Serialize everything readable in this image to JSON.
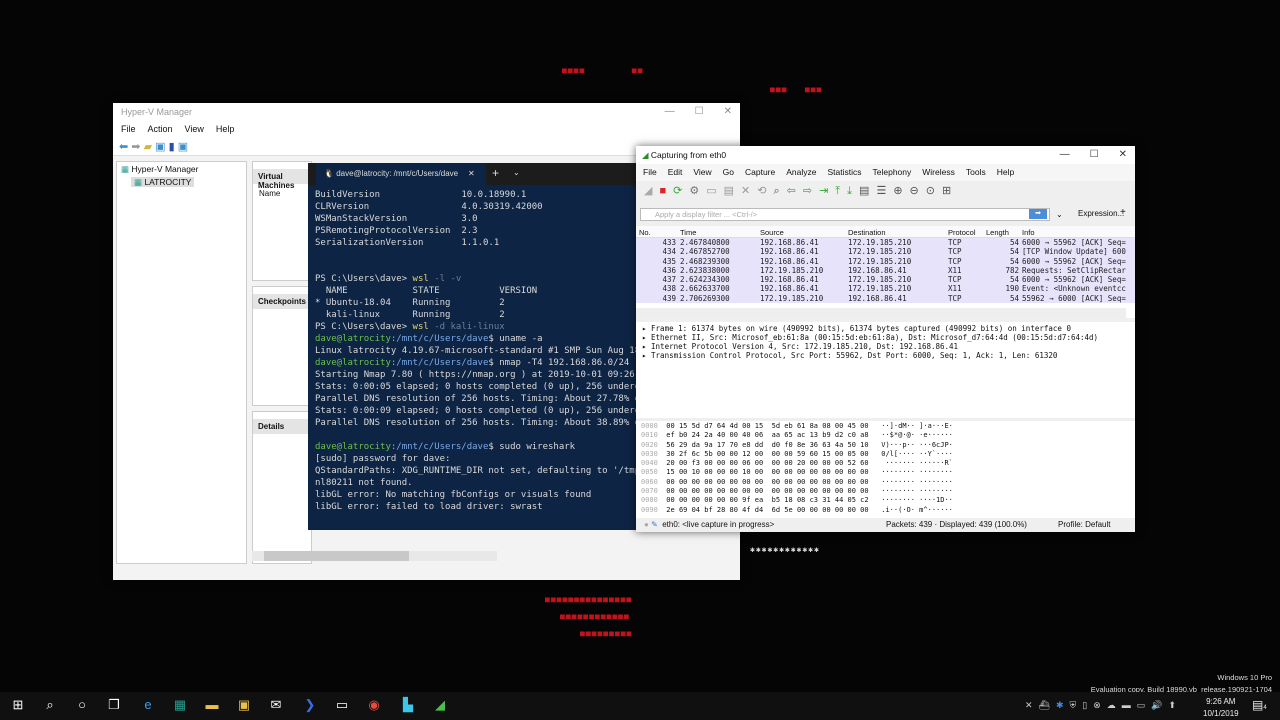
{
  "hyperv": {
    "title": "Hyper-V Manager",
    "menu": [
      "File",
      "Action",
      "View",
      "Help"
    ],
    "tree_root": "Hyper-V Manager",
    "tree_child": "LATROCITY",
    "vm_header": "Virtual Machines",
    "name_col": "Name",
    "checkpoints": "Checkpoints",
    "details": "Details"
  },
  "terminal": {
    "tab_title": "dave@latrocity: /mnt/c/Users/dave",
    "props": [
      [
        "BuildVersion",
        "10.0.18990.1"
      ],
      [
        "CLRVersion",
        "4.0.30319.42000"
      ],
      [
        "WSManStackVersion",
        "3.0"
      ],
      [
        "PSRemotingProtocolVersion",
        "2.3"
      ],
      [
        "SerializationVersion",
        "1.1.0.1"
      ]
    ],
    "lines": [
      {
        "p": "PS C:\\Users\\dave> ",
        "c": "wsl",
        "a": " -l -v"
      },
      {
        "t": "  NAME            STATE           VERSION"
      },
      {
        "t": "* Ubuntu-18.04    Running         2"
      },
      {
        "t": "  kali-linux      Running         2"
      },
      {
        "p": "PS C:\\Users\\dave> ",
        "c": "wsl",
        "a": " -d kali-linux"
      },
      {
        "u": "dave@latrocity",
        "d": ":/mnt/c/Users/dave",
        "s": "$ uname -a"
      },
      {
        "t": "Linux latrocity 4.19.67-microsoft-standard #1 SMP Sun Aug 18"
      },
      {
        "u": "dave@latrocity",
        "d": ":/mnt/c/Users/dave",
        "s": "$ nmap -T4 192.168.86.0/24"
      },
      {
        "t": "Starting Nmap 7.80 ( https://nmap.org ) at 2019-10-01 09:26"
      },
      {
        "t": "Stats: 0:00:05 elapsed; 0 hosts completed (0 up), 256 underg"
      },
      {
        "t": "Parallel DNS resolution of 256 hosts. Timing: About 27.78% d"
      },
      {
        "t": "Stats: 0:00:09 elapsed; 0 hosts completed (0 up), 256 underg"
      },
      {
        "t": "Parallel DNS resolution of 256 hosts. Timing: About 38.89% d"
      },
      {
        "t": ""
      },
      {
        "u": "dave@latrocity",
        "d": ":/mnt/c/Users/dave",
        "s": "$ sudo wireshark"
      },
      {
        "t": "[sudo] password for dave:"
      },
      {
        "t": "QStandardPaths: XDG_RUNTIME_DIR not set, defaulting to '/tmp"
      },
      {
        "t": "nl80211 not found."
      },
      {
        "t": "libGL error: No matching fbConfigs or visuals found"
      },
      {
        "t": "libGL error: failed to load driver: swrast"
      }
    ]
  },
  "wireshark": {
    "title": "Capturing from eth0",
    "menu": [
      "File",
      "Edit",
      "View",
      "Go",
      "Capture",
      "Analyze",
      "Statistics",
      "Telephony",
      "Wireless",
      "Tools",
      "Help"
    ],
    "filter_placeholder": "Apply a display filter ... <Ctrl-/>",
    "expression": "Expression...",
    "columns": [
      "No.",
      "Time",
      "Source",
      "Destination",
      "Protocol",
      "Length",
      "Info"
    ],
    "packets": [
      [
        "433",
        "2.467840800",
        "192.168.86.41",
        "172.19.185.210",
        "TCP",
        "54",
        "6000 → 55962 [ACK] Seq="
      ],
      [
        "434",
        "2.467852700",
        "192.168.86.41",
        "172.19.185.210",
        "TCP",
        "54",
        "[TCP Window Update] 600"
      ],
      [
        "435",
        "2.468239300",
        "192.168.86.41",
        "172.19.185.210",
        "TCP",
        "54",
        "6000 → 55962 [ACK] Seq="
      ],
      [
        "436",
        "2.623838000",
        "172.19.185.210",
        "192.168.86.41",
        "X11",
        "782",
        "Requests: SetClipRectar"
      ],
      [
        "437",
        "2.624234300",
        "192.168.86.41",
        "172.19.185.210",
        "TCP",
        "54",
        "6000 → 55962 [ACK] Seq="
      ],
      [
        "438",
        "2.662633700",
        "192.168.86.41",
        "172.19.185.210",
        "X11",
        "190",
        "Event: <Unknown eventcc"
      ],
      [
        "439",
        "2.706269300",
        "172.19.185.210",
        "192.168.86.41",
        "TCP",
        "54",
        "55962 → 6000 [ACK] Seq="
      ]
    ],
    "details": [
      "Frame 1: 61374 bytes on wire (490992 bits), 61374 bytes captured (490992 bits) on interface 0",
      "Ethernet II, Src: Microsof_eb:61:8a (00:15:5d:eb:61:8a), Dst: Microsof_d7:64:4d (00:15:5d:d7:64:4d)",
      "Internet Protocol Version 4, Src: 172.19.185.210, Dst: 192.168.86.41",
      "Transmission Control Protocol, Src Port: 55962, Dst Port: 6000, Seq: 1, Ack: 1, Len: 61320"
    ],
    "bytes": [
      [
        "0000",
        "00 15 5d d7 64 4d 00 15  5d eb 61 8a 08 00 45 00",
        "··]·dM·· ]·a···E·"
      ],
      [
        "0010",
        "ef b0 24 2a 40 00 40 06  aa 65 ac 13 b9 d2 c0 a8",
        "··$*@·@· ·e······"
      ],
      [
        "0020",
        "56 29 da 9a 17 70 e8 dd  d0 f0 8e 36 63 4a 50 10",
        "V)···p·· ···6cJP·"
      ],
      [
        "0030",
        "30 2f 6c 5b 00 00 12 00  00 00 59 60 15 00 05 00",
        "0/l[···· ··Y`····"
      ],
      [
        "0040",
        "20 00 f3 00 00 00 06 00  00 00 20 00 00 00 52 60",
        " ······· ······R`"
      ],
      [
        "0050",
        "15 00 10 00 00 00 10 00  00 00 00 00 00 00 00 00",
        "········ ········"
      ],
      [
        "0060",
        "00 00 00 00 00 00 00 00  00 00 00 00 00 00 00 00",
        "········ ········"
      ],
      [
        "0070",
        "00 00 00 00 00 00 00 00  00 00 00 00 00 00 00 00",
        "········ ········"
      ],
      [
        "0080",
        "00 00 00 00 00 00 9f ea  b5 18 08 c3 31 44 05 c2",
        "········ ····1D··"
      ],
      [
        "0090",
        "2e 69 04 bf 28 80 4f d4  6d 5e 00 00 00 00 00 00",
        ".i··(·O· m^······"
      ]
    ],
    "status_iface": "eth0: <live capture in progress>",
    "status_packets": "Packets: 439 · Displayed: 439 (100.0%)",
    "status_profile": "Profile: Default"
  },
  "desktop": {
    "watermark1": "Windows 10 Pro",
    "watermark2": "Evaluation copy. Build 18990.vb_release.190921-1704",
    "time": "9:26 AM",
    "date": "10/1/2019",
    "notifications": "4"
  },
  "colors": {
    "accent": "#0078d7",
    "term_bg": "#0d2444",
    "row_bg": "#e6e3fb"
  }
}
